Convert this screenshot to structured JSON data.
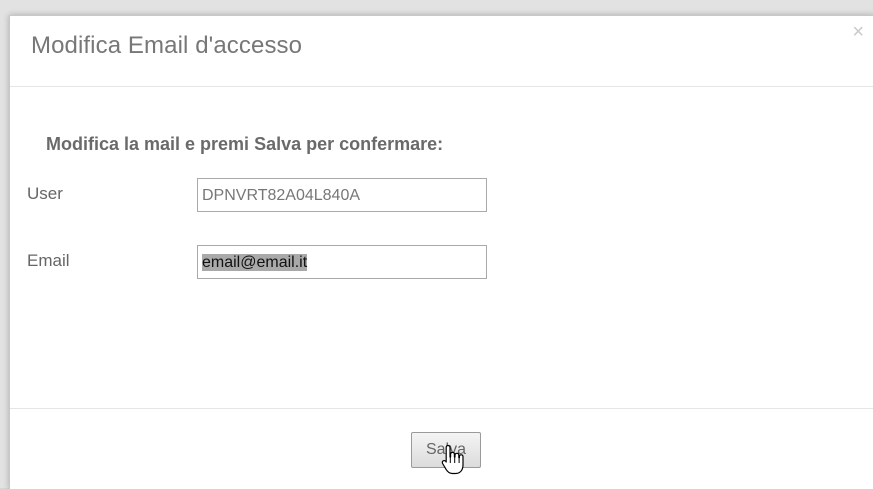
{
  "dialog": {
    "title": "Modifica Email d'accesso",
    "close_label": "×",
    "instruction": "Modifica la mail e premi Salva per confermare:"
  },
  "form": {
    "user": {
      "label": "User",
      "value": "DPNVRT82A04L840A"
    },
    "email": {
      "label": "Email",
      "value": "email@email.it"
    }
  },
  "footer": {
    "save_label": "Salva"
  },
  "icons": {
    "cursor": "hand-pointer-icon"
  }
}
